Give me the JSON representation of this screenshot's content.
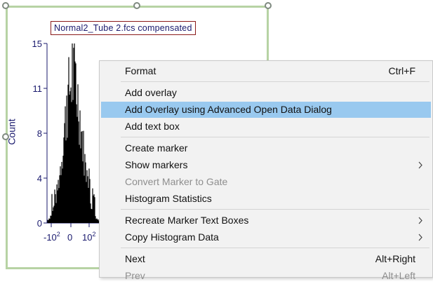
{
  "plot": {
    "title": "Normal2_Tube 2.fcs compensated",
    "y_axis_label": "Count",
    "y_ticks": [
      "15",
      "11",
      "8",
      "4",
      "0"
    ],
    "x_ticks": [
      "-10",
      "0",
      "10"
    ],
    "x_tick_exponent": "2",
    "histogram_color": "#000000",
    "selection_border_color": "#b7d3a4"
  },
  "context_menu": {
    "highlight_color": "#99c9ef",
    "items": [
      {
        "label": "Format",
        "shortcut": "Ctrl+F"
      },
      {
        "label": "Add overlay"
      },
      {
        "label": "Add Overlay using Advanced Open Data Dialog",
        "highlighted": true
      },
      {
        "label": "Add text box"
      },
      {
        "label": "Create marker"
      },
      {
        "label": "Show markers",
        "submenu": true
      },
      {
        "label": "Convert Marker to Gate",
        "disabled": true
      },
      {
        "label": "Histogram Statistics"
      },
      {
        "label": "Recreate Marker Text Boxes",
        "submenu": true
      },
      {
        "label": "Copy Histogram Data",
        "submenu": true
      },
      {
        "label": "Next",
        "shortcut": "Alt+Right"
      },
      {
        "label": "Prev",
        "shortcut": "Alt+Left",
        "disabled": true
      }
    ]
  }
}
